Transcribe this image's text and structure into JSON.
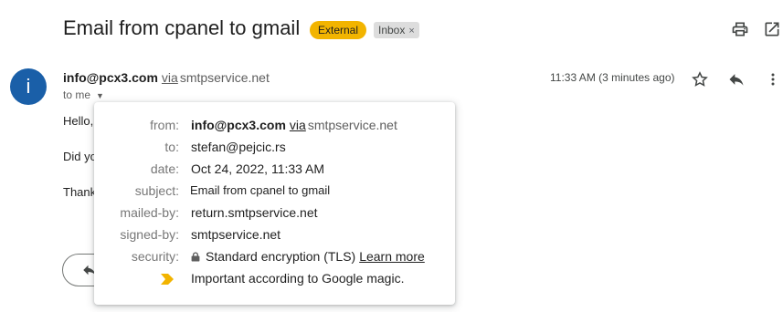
{
  "email": {
    "subject": "Email from cpanel to gmail",
    "badge_external": "External",
    "label_inbox": "Inbox",
    "label_close": "×"
  },
  "sender": {
    "avatar_letter": "i",
    "address": "info@pcx3.com",
    "via": "via",
    "via_domain": "smtpservice.net",
    "to_me": "to me",
    "time": "11:33 AM (3 minutes ago)"
  },
  "body": {
    "line1": "Hello,",
    "line2": "Did yo",
    "line3": "Thank"
  },
  "details": {
    "from_label": "from:",
    "from_address": "info@pcx3.com",
    "from_via": "via",
    "from_domain": "smtpservice.net",
    "to_label": "to:",
    "to_value": "stefan@pejcic.rs",
    "date_label": "date:",
    "date_value": "Oct 24, 2022, 11:33 AM",
    "subject_label": "subject:",
    "subject_value": "Email from cpanel to gmail",
    "mailed_by_label": "mailed-by:",
    "mailed_by_value": "return.smtpservice.net",
    "signed_by_label": "signed-by:",
    "signed_by_value": "smtpservice.net",
    "security_label": "security:",
    "security_value": "Standard encryption (TLS)",
    "learn_more": "Learn more",
    "importance_value": "Important according to Google magic."
  },
  "colors": {
    "external_badge": "#f2b400",
    "importance_marker": "#f2b400",
    "avatar": "#1a5fa8"
  },
  "icons": [
    "print-icon",
    "open-in-new-window-icon",
    "star-icon",
    "reply-icon",
    "more-vert-icon",
    "lock-icon",
    "importance-marker-icon"
  ]
}
